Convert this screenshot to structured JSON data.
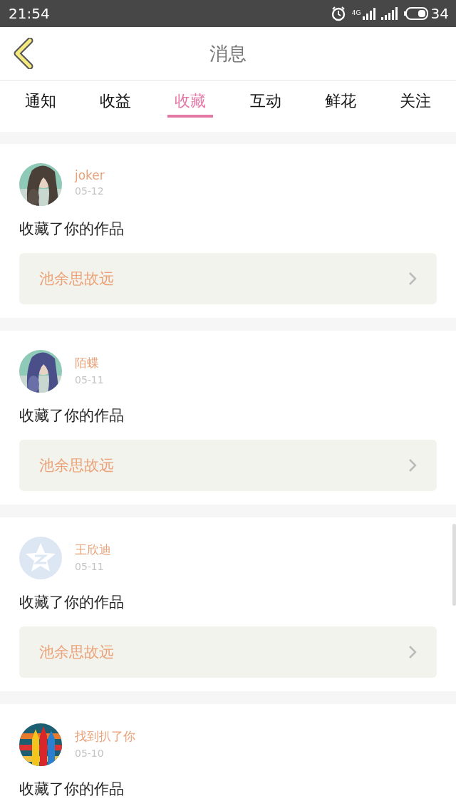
{
  "status_bar": {
    "time": "21:54",
    "network": "4G",
    "battery": "34"
  },
  "header": {
    "title": "消息"
  },
  "tabs": [
    {
      "label": "通知",
      "selected": false
    },
    {
      "label": "收益",
      "selected": false
    },
    {
      "label": "收藏",
      "selected": true
    },
    {
      "label": "互动",
      "selected": false
    },
    {
      "label": "鲜花",
      "selected": false
    },
    {
      "label": "关注",
      "selected": false
    }
  ],
  "messages": [
    {
      "name": "joker",
      "date": "05-12",
      "text": "收藏了你的作品",
      "work": "池余思故远"
    },
    {
      "name": "陌蝶",
      "date": "05-11",
      "text": "收藏了你的作品",
      "work": "池余思故远"
    },
    {
      "avatar": {
        "kind": "default"
      },
      "name": "王欣迪",
      "date": "05-11",
      "text": "收藏了你的作品",
      "work": "池余思故远"
    },
    {
      "avatar": {
        "kind": "pencils"
      },
      "name": "找到扒了你",
      "date": "05-10",
      "text": "收藏了你的作品"
    }
  ]
}
